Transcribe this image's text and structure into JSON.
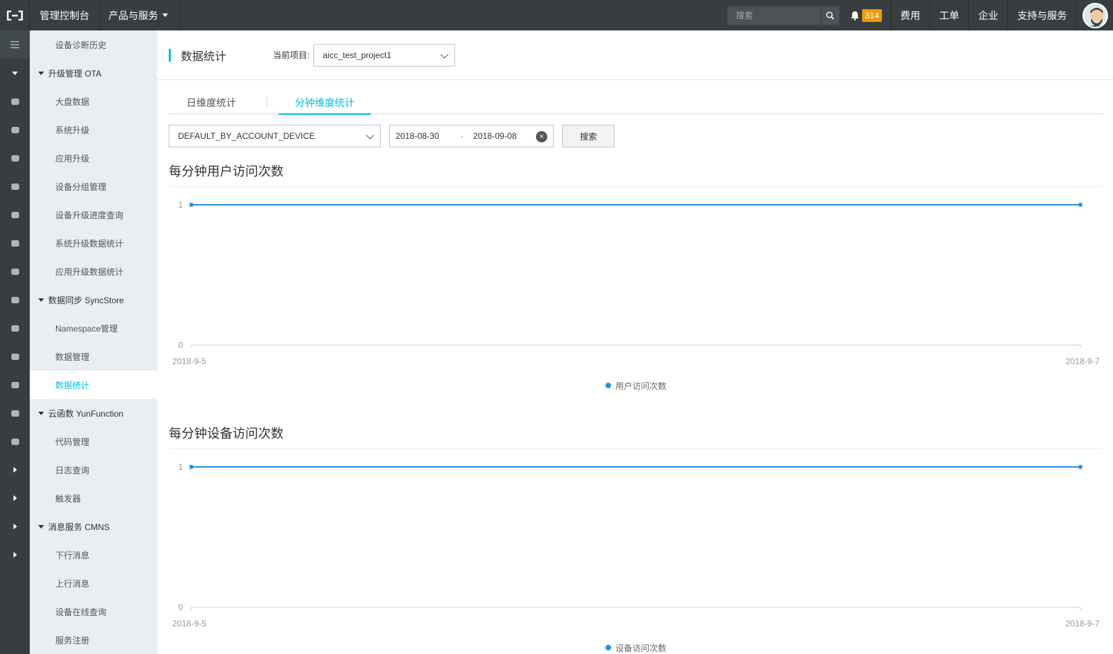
{
  "topbar": {
    "console": "管理控制台",
    "products": "产品与服务",
    "search_placeholder": "搜索",
    "notification_count": "314",
    "links": [
      "费用",
      "工单",
      "企业",
      "支持与服务"
    ]
  },
  "rail": {
    "icons": [
      "menu-icon",
      "collapse-icon",
      "server-icon",
      "storage-icon",
      "network-icon",
      "cloud-up-icon",
      "box-icon",
      "cloud-icon",
      "link-icon",
      "cloud-outline-icon",
      "cluster-icon",
      "link-icon",
      "box-icon",
      "share-icon",
      "cross-icon",
      "expand-icon",
      "expand-icon",
      "expand-icon",
      "expand-icon"
    ]
  },
  "sidebar": {
    "items": [
      {
        "type": "item",
        "label": "设备诊断历史"
      },
      {
        "type": "group",
        "label": "升级管理 OTA"
      },
      {
        "type": "item",
        "label": "大盘数据"
      },
      {
        "type": "item",
        "label": "系统升级"
      },
      {
        "type": "item",
        "label": "应用升级"
      },
      {
        "type": "item",
        "label": "设备分组管理"
      },
      {
        "type": "item",
        "label": "设备升级进度查询"
      },
      {
        "type": "item",
        "label": "系统升级数据统计"
      },
      {
        "type": "item",
        "label": "应用升级数据统计"
      },
      {
        "type": "group",
        "label": "数据同步 SyncStore"
      },
      {
        "type": "item",
        "label": "Namespace管理"
      },
      {
        "type": "item",
        "label": "数据管理"
      },
      {
        "type": "item",
        "label": "数据统计",
        "active": true
      },
      {
        "type": "group",
        "label": "云函数 YunFunction"
      },
      {
        "type": "item",
        "label": "代码管理"
      },
      {
        "type": "item",
        "label": "日志查询"
      },
      {
        "type": "item",
        "label": "触发器"
      },
      {
        "type": "group",
        "label": "消息服务 CMNS"
      },
      {
        "type": "item",
        "label": "下行消息"
      },
      {
        "type": "item",
        "label": "上行消息"
      },
      {
        "type": "item",
        "label": "设备在线查询"
      },
      {
        "type": "item",
        "label": "服务注册"
      }
    ]
  },
  "header": {
    "title": "数据统计",
    "project_label": "当前项目:",
    "project_value": "aicc_test_project1"
  },
  "tabs": [
    "日维度统计",
    "分钟维度统计"
  ],
  "filters": {
    "type_value": "DEFAULT_BY_ACCOUNT_DEVICE",
    "date_start": "2018-08-30",
    "date_sep": "-",
    "date_end": "2018-09-08",
    "search_button": "搜索"
  },
  "colors": {
    "accent": "#00c1de",
    "series": "#2592e8"
  },
  "chart_data": [
    {
      "type": "line",
      "title": "每分钟用户访问次数",
      "x": [
        "2018-9-5",
        "2018-9-7"
      ],
      "series": [
        {
          "name": "用户访问次数",
          "values": [
            1,
            1
          ]
        }
      ],
      "ylim": [
        0,
        1
      ],
      "yticks": [
        "1",
        "0"
      ],
      "legend": "bottom-center",
      "grid": false
    },
    {
      "type": "line",
      "title": "每分钟设备访问次数",
      "x": [
        "2018-9-5",
        "2018-9-7"
      ],
      "series": [
        {
          "name": "设备访问次数",
          "values": [
            1,
            1
          ]
        }
      ],
      "ylim": [
        0,
        1
      ],
      "yticks": [
        "1",
        "0"
      ],
      "legend": "bottom-center",
      "grid": false
    }
  ]
}
